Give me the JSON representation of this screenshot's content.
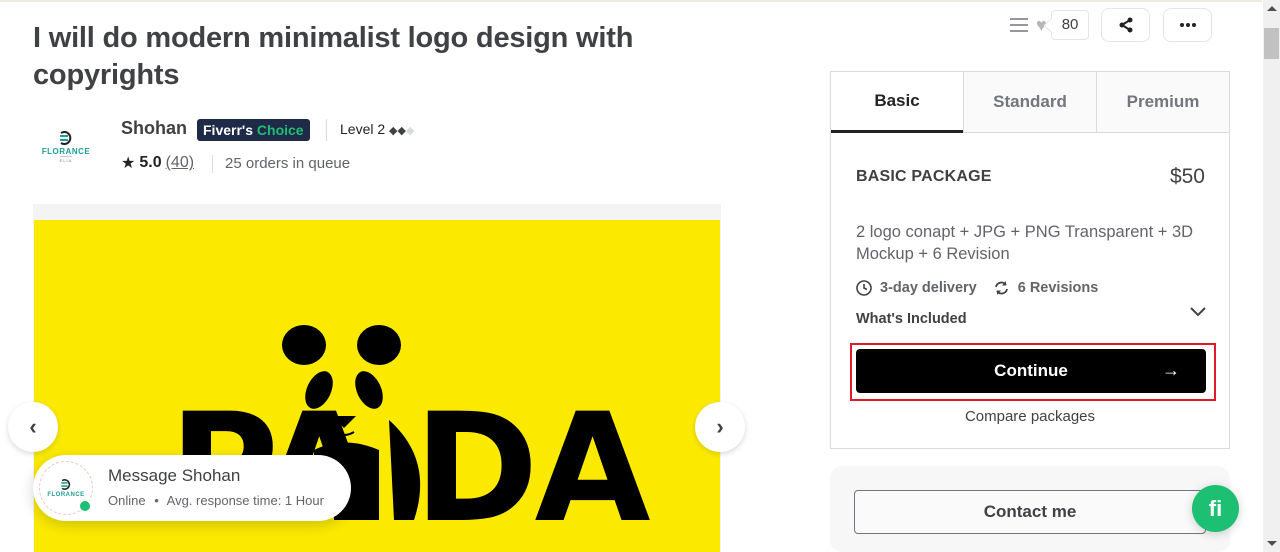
{
  "gig": {
    "title": "I will do modern minimalist logo design with copyrights"
  },
  "seller": {
    "name": "Shohan",
    "logo_text": "FLORANCE",
    "logo_subtext": "ELIA",
    "badge_prefix": "Fiverr's",
    "badge_suffix": "Choice",
    "level": "Level 2",
    "level_diamonds_filled": 2,
    "level_diamonds_total": 3,
    "rating": "5.0",
    "review_count": "(40)",
    "queue": "25 orders in queue"
  },
  "top_actions": {
    "like_count": "80",
    "collect_icon": "list-icon",
    "heart_icon": "heart-icon",
    "share_icon": "share-icon",
    "more_icon": "more-dots-icon"
  },
  "gallery": {
    "image_text": "PANDA",
    "prev_icon": "chevron-left-icon",
    "next_icon": "chevron-right-icon"
  },
  "message_card": {
    "title": "Message Shohan",
    "status": "Online",
    "separator": "•",
    "response": "Avg. response time: 1 Hour"
  },
  "package": {
    "tabs": [
      {
        "label": "Basic",
        "active": true
      },
      {
        "label": "Standard",
        "active": false
      },
      {
        "label": "Premium",
        "active": false
      }
    ],
    "name": "BASIC PACKAGE",
    "price": "$50",
    "description": "2 logo conapt + JPG + PNG Transparent + 3D Mockup + 6 Revision",
    "delivery": "3-day delivery",
    "revisions": "6 Revisions",
    "included_label": "What's Included",
    "continue_label": "Continue",
    "continue_arrow": "→",
    "compare_label": "Compare packages"
  },
  "contact": {
    "label": "Contact me",
    "chat_badge": "fi"
  },
  "colors": {
    "brand_green": "#1dbf73",
    "badge_navy": "#1e2a48",
    "gallery_yellow": "#fbea00",
    "highlight_red": "#e2192b"
  }
}
